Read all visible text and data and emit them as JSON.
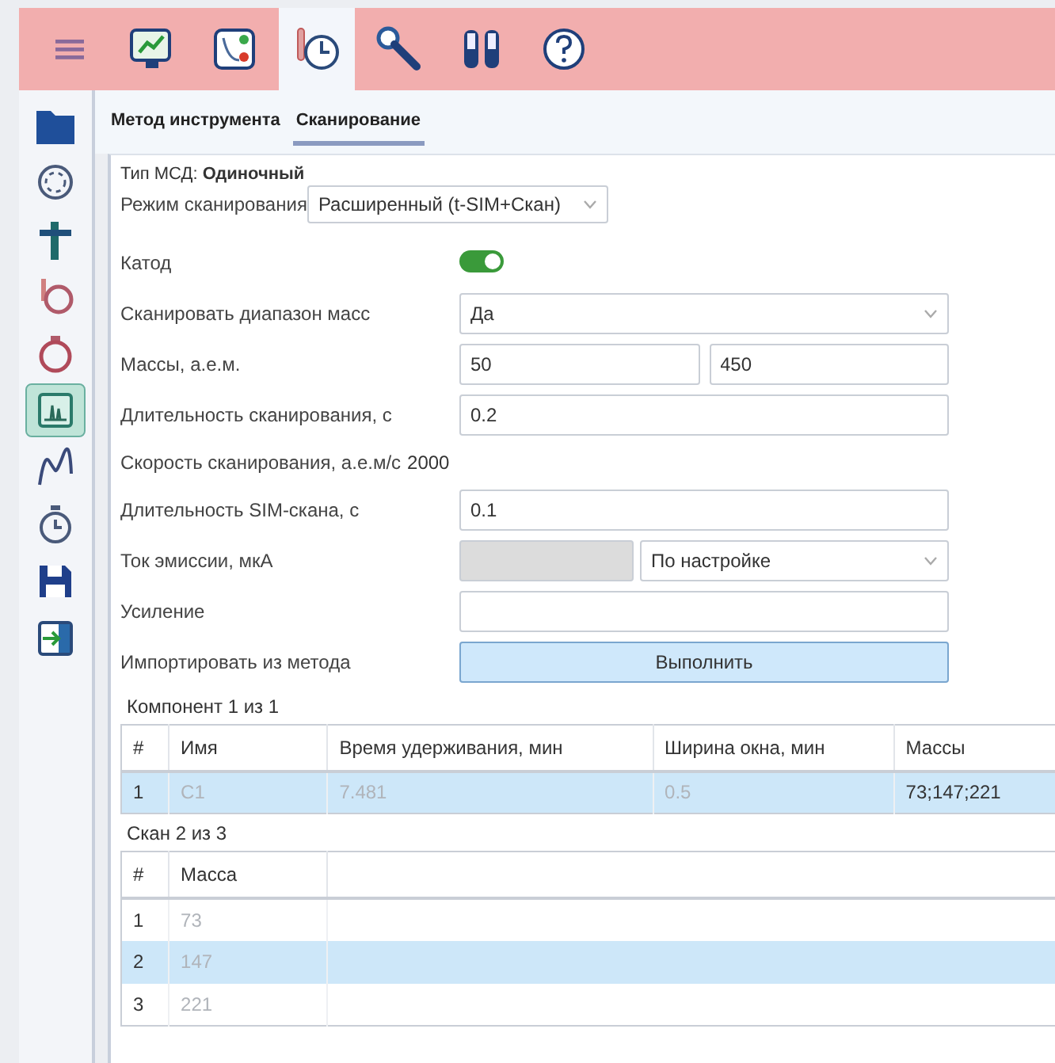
{
  "toolbar": [
    {
      "selected": false
    },
    {
      "selected": false
    },
    {
      "selected": false
    },
    {
      "selected": true
    },
    {
      "selected": false
    },
    {
      "selected": false
    },
    {
      "selected": false
    }
  ],
  "sidebar": [
    {
      "selected": false
    },
    {
      "selected": false
    },
    {
      "selected": false
    },
    {
      "selected": false
    },
    {
      "selected": false
    },
    {
      "selected": true
    },
    {
      "selected": false
    },
    {
      "selected": false
    },
    {
      "selected": false
    },
    {
      "selected": false
    }
  ],
  "tabs": [
    {
      "label": "Метод инструмента",
      "selected": false
    },
    {
      "label": "Сканирование",
      "selected": true
    }
  ],
  "msd_type": "Тип МСД: **Одиночный**",
  "scan_mode": {
    "label": "Режим сканирования",
    "value": "Расширенный (t-SIM+Скан)"
  },
  "fields": [
    {
      "kind": "toggle",
      "label": "Катод",
      "on": true
    },
    {
      "kind": "select",
      "label": "Сканировать диапазон масс",
      "value": "Да"
    },
    {
      "kind": "range",
      "label": "Массы, а.е.м.",
      "from": "50",
      "to": "450"
    },
    {
      "kind": "input",
      "label": "Длительность сканирования, с",
      "value": "0.2"
    },
    {
      "kind": "readout",
      "label": "Скорость сканирования, а.е.м/с",
      "value": "2000"
    },
    {
      "kind": "input",
      "label": "Длительность SIM-скана, с",
      "value": "0.1"
    },
    {
      "kind": "combo",
      "label": "Ток эмиссии, мкА",
      "value": "По настройке"
    },
    {
      "kind": "input",
      "label": "Усиление"
    },
    {
      "kind": "button",
      "label": "Импортировать из метода",
      "button": "Выполнить"
    }
  ],
  "components": {
    "caption": "Компонент 1 из 1",
    "columns": [
      {
        "label": "#",
        "muted": false
      },
      {
        "label": "Имя",
        "muted": true
      },
      {
        "label": "Время удерживания, мин",
        "muted": true
      },
      {
        "label": "Ширина окна, мин",
        "muted": true
      },
      {
        "label": "Массы",
        "muted": false
      }
    ],
    "rows": [
      {
        "selected": true,
        "cells": [
          "1",
          "C1",
          "7.481",
          "0.5",
          "73;147;221"
        ]
      }
    ]
  },
  "scans": {
    "caption": "Скан 2 из 3",
    "columns": [
      {
        "label": "#",
        "muted": false
      },
      {
        "label": "Масса",
        "muted": true
      }
    ],
    "rows": [
      {
        "selected": false,
        "cells": [
          "1",
          "73"
        ]
      },
      {
        "selected": true,
        "cells": [
          "2",
          "147"
        ]
      },
      {
        "selected": false,
        "cells": [
          "3",
          "221"
        ]
      }
    ]
  }
}
